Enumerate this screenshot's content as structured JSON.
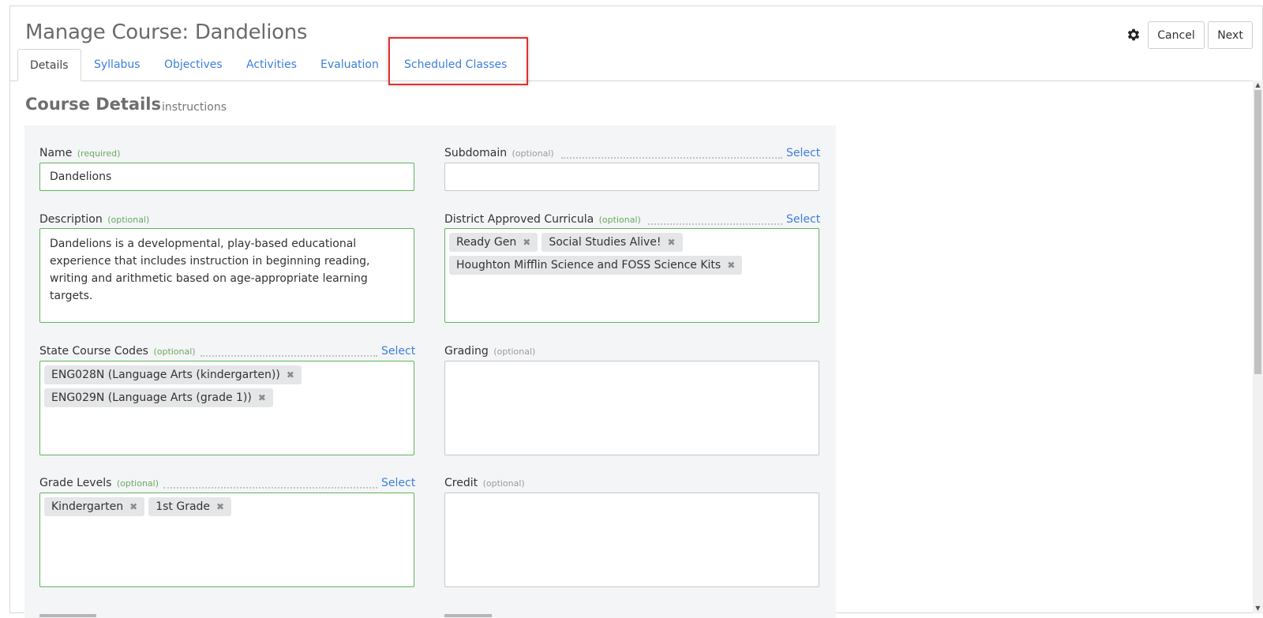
{
  "header": {
    "title": "Manage Course: Dandelions",
    "cancel_label": "Cancel",
    "next_label": "Next",
    "settings_icon": "gear-icon"
  },
  "tabs": [
    {
      "label": "Details",
      "active": true
    },
    {
      "label": "Syllabus"
    },
    {
      "label": "Objectives"
    },
    {
      "label": "Activities"
    },
    {
      "label": "Evaluation"
    },
    {
      "label": "Scheduled Classes",
      "highlighted": true
    }
  ],
  "section": {
    "title": "Course Details",
    "subtitle": "instructions"
  },
  "select_label": "Select",
  "fields": {
    "name": {
      "label": "Name",
      "tag": "(required)",
      "value": "Dandelions"
    },
    "subdomain": {
      "label": "Subdomain",
      "tag": "(optional)",
      "value": ""
    },
    "description": {
      "label": "Description",
      "tag": "(optional)",
      "value": "Dandelions is a developmental, play-based educational experience that includes instruction in beginning reading, writing and arithmetic based on age-appropriate learning targets."
    },
    "curricula": {
      "label": "District Approved Curricula",
      "tag": "(optional)",
      "items": [
        "Ready Gen",
        "Social Studies Alive!",
        "Houghton Mifflin Science and FOSS Science Kits"
      ]
    },
    "state_codes": {
      "label": "State Course Codes",
      "tag": "(optional)",
      "items": [
        "ENG028N (Language Arts (kindergarten))",
        "ENG029N (Language Arts (grade 1))"
      ]
    },
    "grading": {
      "label": "Grading",
      "tag": "(optional)",
      "value": ""
    },
    "grade_levels": {
      "label": "Grade Levels",
      "tag": "(optional)",
      "items": [
        "Kindergarten",
        "1st Grade"
      ]
    },
    "credit": {
      "label": "Credit",
      "tag": "(optional)",
      "value": ""
    }
  },
  "remove_glyph": "✖",
  "colors": {
    "link": "#3d7ede",
    "valid_border": "#5fb55a",
    "highlight": "#e0312f",
    "panel_bg": "#f4f5f7"
  }
}
